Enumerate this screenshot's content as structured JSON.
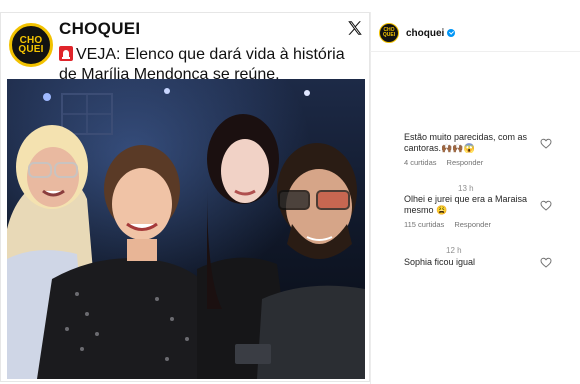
{
  "post": {
    "brand": "CHOQUEI",
    "logo_top": "CHO",
    "logo_bottom": "QUEI",
    "headline_prefix": "VEJA:",
    "headline_rest": " Elenco que dará vida à história de Marília Mendonça se reúne.",
    "icons": {
      "platform": "x-logo-icon",
      "alert": "siren-icon"
    }
  },
  "instagram": {
    "username": "choquei",
    "verified": true,
    "comments": [
      {
        "text": "Estão muito parecidas, com as cantoras.",
        "emojis": [
          "🙌🏾",
          "🙌🏾",
          "😱"
        ],
        "likes": "4 curtidas",
        "reply": "Responder",
        "time": ""
      },
      {
        "text": "Olhei e jurei que era a Maraisa mesmo",
        "emojis": [
          "😩"
        ],
        "likes": "115 curtidas",
        "reply": "Responder",
        "time": "13 h"
      },
      {
        "text": "Sophia ficou igual",
        "emojis": [],
        "likes": "",
        "reply": "",
        "time": "12 h"
      }
    ]
  },
  "colors": {
    "brand_yellow": "#f5c400",
    "verified_blue": "#0095f6",
    "siren_red": "#e0252b"
  }
}
